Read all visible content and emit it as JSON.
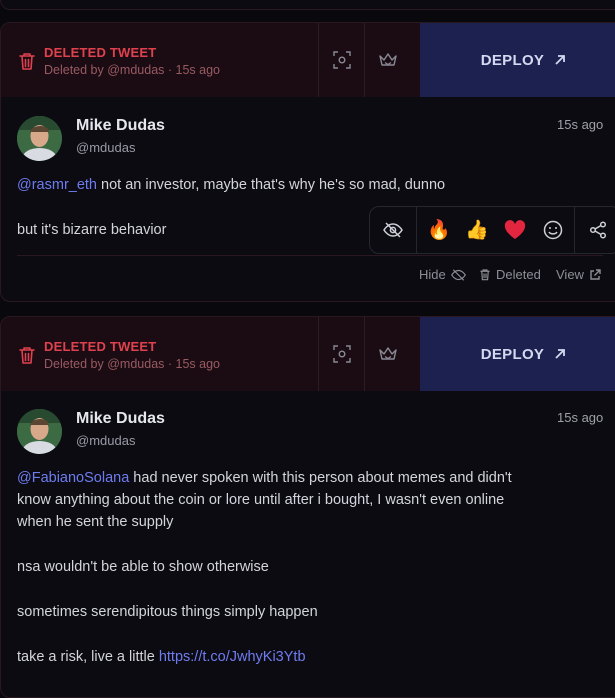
{
  "tweets": [
    {
      "banner": {
        "title": "DELETED TWEET",
        "subtitle": "Deleted by @mdudas · 15s ago",
        "deploy_label": "DEPLOY",
        "icons": [
          "trash-icon",
          "scan-icon",
          "crown-icon",
          "arrow-up-right-icon"
        ]
      },
      "author": {
        "name": "Mike Dudas",
        "handle": "@mdudas",
        "time": "15s ago"
      },
      "body": {
        "mention": "@rasmr_eth",
        "line1": " not an investor, maybe that's why he's so mad, dunno",
        "line2": "but it's bizarre behavior"
      },
      "reactions": {
        "icons": [
          "eye-off-icon",
          "fire-emoji",
          "thumbs-up-emoji",
          "heart-emoji",
          "smiley-icon",
          "share-icon"
        ],
        "fire": "🔥",
        "thumbs": "👍"
      },
      "actions": {
        "hide": "Hide",
        "deleted": "Deleted",
        "view": "View"
      }
    },
    {
      "banner": {
        "title": "DELETED TWEET",
        "subtitle": "Deleted by @mdudas · 15s ago",
        "deploy_label": "DEPLOY"
      },
      "author": {
        "name": "Mike Dudas",
        "handle": "@mdudas",
        "time": "15s ago"
      },
      "body": {
        "mention": "@FabianoSolana",
        "line1": " had never spoken with this person about memes and didn't",
        "line2": "know anything about the coin or lore until after i bought, I wasn't even online",
        "line3": "when he sent the supply",
        "para2": "nsa wouldn't be able to show otherwise",
        "para3": "sometimes serendipitous things simply happen",
        "para4": "take a risk, live a little ",
        "link": "https://t.co/JwhyKi3Ytb"
      }
    }
  ],
  "colors": {
    "background": "#08080d",
    "deleted_red": "#e0414f",
    "deploy_bg": "#1c2150",
    "link": "#6f7cf0"
  }
}
